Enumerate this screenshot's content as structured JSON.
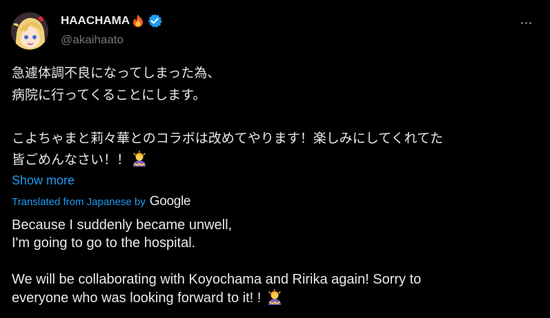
{
  "author": {
    "display_name": "HAACHAMA",
    "handle": "@akaihaato",
    "name_emoji_icon": "fire-icon",
    "badge_icon": "verified-badge-icon"
  },
  "menu": {
    "icon": "more-horizontal-icon"
  },
  "original": {
    "lines": [
      "急遽体調不良になってしまった為、",
      "病院に行ってくることにします。",
      "",
      "こよちゃまと莉々華とのコラボは改めてやります！楽しみにしてくれてた",
      "皆ごめんなさい！！"
    ],
    "trailing_emoji_icon": "person-bowing-icon"
  },
  "show_more": "Show more",
  "translation": {
    "credit_prefix": "Translated from Japanese by",
    "credit_brand": "Google",
    "lines": [
      "Because I suddenly became unwell,",
      "I'm going to go to the hospital.",
      "",
      "We will be collaborating with Koyochama and Ririka again! Sorry to",
      "everyone who was looking forward to it! !"
    ],
    "trailing_emoji_icon": "person-bowing-icon"
  },
  "colors": {
    "background": "#000000",
    "text": "#e7e9ea",
    "secondary_text": "#71767b",
    "link": "#1d9bf0"
  }
}
